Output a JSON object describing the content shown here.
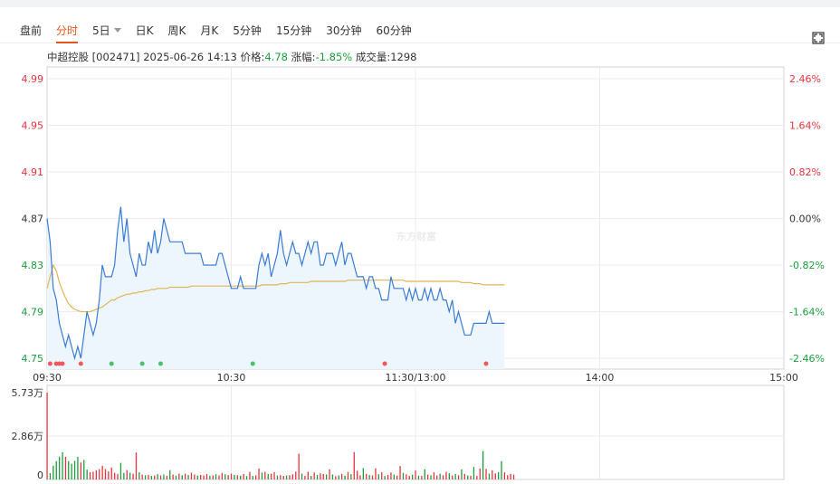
{
  "tabs": [
    {
      "label": "盘前",
      "active": false
    },
    {
      "label": "分时",
      "active": true
    },
    {
      "label": "5日",
      "active": false,
      "dropdown": true
    },
    {
      "label": "日K",
      "active": false
    },
    {
      "label": "周K",
      "active": false
    },
    {
      "label": "月K",
      "active": false
    },
    {
      "label": "5分钟",
      "active": false
    },
    {
      "label": "15分钟",
      "active": false
    },
    {
      "label": "30分钟",
      "active": false
    },
    {
      "label": "60分钟",
      "active": false
    }
  ],
  "fullscreen_icon": "fullscreen-icon",
  "info": {
    "name": "中超控股",
    "code": "[002471]",
    "datetime": "2025-06-26 14:13",
    "price_label": "价格:",
    "price": "4.78",
    "change_label": "涨幅:",
    "change": "-1.85%",
    "volume_label": "成交量:",
    "volume": "1298"
  },
  "watermark": "东方财富",
  "colors": {
    "up": "#e8323c",
    "down": "#1a9d3c",
    "price_line": "#3a7bd5",
    "avg_line": "#e0b458",
    "area_fill": "#eef6fd",
    "active_tab": "#e8541e"
  },
  "chart_data": {
    "type": "line",
    "price_ticks": [
      "4.99",
      "4.95",
      "4.91",
      "4.87",
      "4.83",
      "4.79",
      "4.75"
    ],
    "percent_ticks": [
      "2.46%",
      "1.64%",
      "0.82%",
      "0.00%",
      "-0.82%",
      "-1.64%",
      "-2.46%"
    ],
    "ylim": [
      4.75,
      4.99
    ],
    "prev_close": 4.87,
    "time_ticks": [
      "09:30",
      "10:30",
      "11:30/13:00",
      "14:00",
      "15:00"
    ],
    "volume_ticks": [
      "5.73万",
      "2.86万",
      "0"
    ],
    "volume_max": 57300,
    "series": [
      {
        "values": [
          4.87,
          4.85,
          4.81,
          4.8,
          4.78,
          4.77,
          4.76,
          4.77,
          4.76,
          4.75,
          4.76,
          4.75,
          4.77,
          4.79,
          4.78,
          4.77,
          4.78,
          4.8,
          4.83,
          4.82,
          4.82,
          4.82,
          4.83,
          4.86,
          4.88,
          4.85,
          4.87,
          4.84,
          4.83,
          4.82,
          4.84,
          4.83,
          4.83,
          4.85,
          4.84,
          4.86,
          4.84,
          4.85,
          4.87,
          4.86,
          4.85,
          4.85,
          4.85,
          4.85,
          4.85,
          4.84,
          4.84,
          4.84,
          4.84,
          4.84,
          4.84,
          4.83,
          4.83,
          4.83,
          4.83,
          4.83,
          4.84,
          4.84,
          4.83,
          4.82,
          4.81,
          4.81,
          4.81,
          4.82,
          4.81,
          4.81,
          4.81,
          4.81,
          4.81,
          4.83,
          4.84,
          4.83,
          4.84,
          4.82,
          4.83,
          4.84,
          4.86,
          4.84,
          4.83,
          4.84,
          4.85,
          4.84,
          4.84,
          4.83,
          4.84,
          4.85,
          4.84,
          4.85,
          4.85,
          4.83,
          4.83,
          4.84,
          4.84,
          4.84,
          4.83,
          4.84,
          4.85,
          4.83,
          4.84,
          4.84,
          4.83,
          4.82,
          4.82,
          4.82,
          4.81,
          4.82,
          4.82,
          4.81,
          4.81,
          4.8,
          4.8,
          4.8,
          4.82,
          4.81,
          4.81,
          4.81,
          4.81,
          4.8,
          4.81,
          4.8,
          4.81,
          4.8,
          4.8,
          4.81,
          4.8,
          4.81,
          4.8,
          4.8,
          4.81,
          4.8,
          4.8,
          4.79,
          4.8,
          4.78,
          4.79,
          4.78,
          4.77,
          4.77,
          4.77,
          4.78,
          4.78,
          4.78,
          4.78,
          4.78,
          4.79,
          4.78,
          4.78,
          4.78,
          4.78,
          4.78
        ]
      },
      {
        "values": [
          4.81,
          4.82,
          4.83,
          4.825,
          4.815,
          4.808,
          4.802,
          4.797,
          4.794,
          4.792,
          4.791,
          4.79,
          4.79,
          4.79,
          4.79,
          4.791,
          4.792,
          4.793,
          4.794,
          4.796,
          4.798,
          4.8,
          4.8,
          4.802,
          4.803,
          4.804,
          4.805,
          4.805,
          4.806,
          4.806,
          4.807,
          4.807,
          4.808,
          4.808,
          4.809,
          4.809,
          4.81,
          4.81,
          4.81,
          4.81,
          4.811,
          4.811,
          4.811,
          4.811,
          4.811,
          4.811,
          4.811,
          4.812,
          4.812,
          4.812,
          4.812,
          4.812,
          4.812,
          4.812,
          4.812,
          4.812,
          4.812,
          4.812,
          4.812,
          4.812,
          4.812,
          4.812,
          4.812,
          4.812,
          4.812,
          4.812,
          4.812,
          4.812,
          4.812,
          4.812,
          4.813,
          4.813,
          4.813,
          4.813,
          4.813,
          4.813,
          4.814,
          4.814,
          4.814,
          4.815,
          4.815,
          4.815,
          4.815,
          4.815,
          4.815,
          4.815,
          4.816,
          4.816,
          4.816,
          4.816,
          4.816,
          4.816,
          4.816,
          4.816,
          4.816,
          4.816,
          4.816,
          4.816,
          4.817,
          4.817,
          4.817,
          4.817,
          4.817,
          4.817,
          4.817,
          4.817,
          4.817,
          4.817,
          4.817,
          4.817,
          4.817,
          4.817,
          4.817,
          4.817,
          4.817,
          4.817,
          4.817,
          4.816,
          4.816,
          4.816,
          4.816,
          4.816,
          4.816,
          4.816,
          4.816,
          4.816,
          4.816,
          4.816,
          4.816,
          4.816,
          4.816,
          4.816,
          4.816,
          4.816,
          4.816,
          4.815,
          4.815,
          4.815,
          4.815,
          4.814,
          4.814,
          4.814,
          4.813,
          4.813,
          4.813,
          4.813,
          4.813,
          4.813,
          4.813,
          4.813
        ]
      }
    ],
    "volume": [
      {
        "v": 57300,
        "c": "up"
      },
      {
        "v": 4200,
        "c": "down"
      },
      {
        "v": 9100,
        "c": "down"
      },
      {
        "v": 12100,
        "c": "down"
      },
      {
        "v": 15100,
        "c": "down"
      },
      {
        "v": 18000,
        "c": "down"
      },
      {
        "v": 15000,
        "c": "up"
      },
      {
        "v": 12100,
        "c": "down"
      },
      {
        "v": 10400,
        "c": "down"
      },
      {
        "v": 12300,
        "c": "down"
      },
      {
        "v": 14900,
        "c": "down"
      },
      {
        "v": 11200,
        "c": "up"
      },
      {
        "v": 12900,
        "c": "down"
      },
      {
        "v": 6500,
        "c": "down"
      },
      {
        "v": 4800,
        "c": "up"
      },
      {
        "v": 5100,
        "c": "up"
      },
      {
        "v": 6100,
        "c": "up"
      },
      {
        "v": 6800,
        "c": "up"
      },
      {
        "v": 9000,
        "c": "up"
      },
      {
        "v": 6900,
        "c": "up"
      },
      {
        "v": 5300,
        "c": "up"
      },
      {
        "v": 7900,
        "c": "up"
      },
      {
        "v": 4400,
        "c": "up"
      },
      {
        "v": 3700,
        "c": "up"
      },
      {
        "v": 11000,
        "c": "down"
      },
      {
        "v": 4300,
        "c": "down"
      },
      {
        "v": 6200,
        "c": "up"
      },
      {
        "v": 4400,
        "c": "down"
      },
      {
        "v": 3800,
        "c": "up"
      },
      {
        "v": 17800,
        "c": "up"
      },
      {
        "v": 4800,
        "c": "down"
      },
      {
        "v": 3200,
        "c": "up"
      },
      {
        "v": 2800,
        "c": "down"
      },
      {
        "v": 3100,
        "c": "up"
      },
      {
        "v": 2300,
        "c": "down"
      },
      {
        "v": 2600,
        "c": "up"
      },
      {
        "v": 3500,
        "c": "down"
      },
      {
        "v": 2700,
        "c": "up"
      },
      {
        "v": 3300,
        "c": "down"
      },
      {
        "v": 2400,
        "c": "up"
      },
      {
        "v": 6200,
        "c": "down"
      },
      {
        "v": 3200,
        "c": "up"
      },
      {
        "v": 2500,
        "c": "down"
      },
      {
        "v": 3800,
        "c": "up"
      },
      {
        "v": 2800,
        "c": "down"
      },
      {
        "v": 3800,
        "c": "up"
      },
      {
        "v": 2900,
        "c": "down"
      },
      {
        "v": 4400,
        "c": "up"
      },
      {
        "v": 3300,
        "c": "up"
      },
      {
        "v": 2600,
        "c": "down"
      },
      {
        "v": 3000,
        "c": "up"
      },
      {
        "v": 2700,
        "c": "up"
      },
      {
        "v": 3600,
        "c": "up"
      },
      {
        "v": 2500,
        "c": "down"
      },
      {
        "v": 2700,
        "c": "up"
      },
      {
        "v": 3500,
        "c": "down"
      },
      {
        "v": 2700,
        "c": "up"
      },
      {
        "v": 4300,
        "c": "up"
      },
      {
        "v": 3400,
        "c": "down"
      },
      {
        "v": 2900,
        "c": "up"
      },
      {
        "v": 3900,
        "c": "up"
      },
      {
        "v": 3100,
        "c": "down"
      },
      {
        "v": 2800,
        "c": "up"
      },
      {
        "v": 2500,
        "c": "down"
      },
      {
        "v": 3600,
        "c": "up"
      },
      {
        "v": 2200,
        "c": "down"
      },
      {
        "v": 5000,
        "c": "up"
      },
      {
        "v": 2300,
        "c": "down"
      },
      {
        "v": 2700,
        "c": "up"
      },
      {
        "v": 7300,
        "c": "up"
      },
      {
        "v": 4600,
        "c": "down"
      },
      {
        "v": 5100,
        "c": "up"
      },
      {
        "v": 3700,
        "c": "down"
      },
      {
        "v": 3800,
        "c": "up"
      },
      {
        "v": 4800,
        "c": "up"
      },
      {
        "v": 2500,
        "c": "down"
      },
      {
        "v": 2800,
        "c": "up"
      },
      {
        "v": 2400,
        "c": "up"
      },
      {
        "v": 2600,
        "c": "down"
      },
      {
        "v": 2800,
        "c": "up"
      },
      {
        "v": 3400,
        "c": "up"
      },
      {
        "v": 5200,
        "c": "up"
      },
      {
        "v": 17000,
        "c": "up"
      },
      {
        "v": 3900,
        "c": "down"
      },
      {
        "v": 2400,
        "c": "up"
      },
      {
        "v": 5100,
        "c": "up"
      },
      {
        "v": 2400,
        "c": "down"
      },
      {
        "v": 4600,
        "c": "up"
      },
      {
        "v": 2900,
        "c": "down"
      },
      {
        "v": 4000,
        "c": "up"
      },
      {
        "v": 3600,
        "c": "up"
      },
      {
        "v": 3300,
        "c": "down"
      },
      {
        "v": 6700,
        "c": "up"
      },
      {
        "v": 3300,
        "c": "down"
      },
      {
        "v": 2200,
        "c": "up"
      },
      {
        "v": 2700,
        "c": "down"
      },
      {
        "v": 3700,
        "c": "up"
      },
      {
        "v": 2500,
        "c": "down"
      },
      {
        "v": 4900,
        "c": "up"
      },
      {
        "v": 3500,
        "c": "down"
      },
      {
        "v": 18100,
        "c": "up"
      },
      {
        "v": 5800,
        "c": "up"
      },
      {
        "v": 2700,
        "c": "up"
      },
      {
        "v": 7500,
        "c": "down"
      },
      {
        "v": 3700,
        "c": "up"
      },
      {
        "v": 3000,
        "c": "down"
      },
      {
        "v": 2600,
        "c": "up"
      },
      {
        "v": 7400,
        "c": "up"
      },
      {
        "v": 3400,
        "c": "down"
      },
      {
        "v": 4800,
        "c": "up"
      },
      {
        "v": 2300,
        "c": "down"
      },
      {
        "v": 3000,
        "c": "up"
      },
      {
        "v": 4600,
        "c": "up"
      },
      {
        "v": 3200,
        "c": "down"
      },
      {
        "v": 2600,
        "c": "up"
      },
      {
        "v": 8900,
        "c": "up"
      },
      {
        "v": 4400,
        "c": "down"
      },
      {
        "v": 3400,
        "c": "up"
      },
      {
        "v": 2400,
        "c": "up"
      },
      {
        "v": 3100,
        "c": "down"
      },
      {
        "v": 5900,
        "c": "up"
      },
      {
        "v": 2500,
        "c": "down"
      },
      {
        "v": 2300,
        "c": "up"
      },
      {
        "v": 6800,
        "c": "down"
      },
      {
        "v": 3200,
        "c": "up"
      },
      {
        "v": 2800,
        "c": "down"
      },
      {
        "v": 4700,
        "c": "up"
      },
      {
        "v": 2700,
        "c": "up"
      },
      {
        "v": 3800,
        "c": "down"
      },
      {
        "v": 2800,
        "c": "up"
      },
      {
        "v": 5100,
        "c": "up"
      },
      {
        "v": 4100,
        "c": "down"
      },
      {
        "v": 2600,
        "c": "up"
      },
      {
        "v": 3600,
        "c": "down"
      },
      {
        "v": 2800,
        "c": "up"
      },
      {
        "v": 6600,
        "c": "down"
      },
      {
        "v": 3700,
        "c": "up"
      },
      {
        "v": 2700,
        "c": "down"
      },
      {
        "v": 2500,
        "c": "up"
      },
      {
        "v": 8300,
        "c": "down"
      },
      {
        "v": 2300,
        "c": "up"
      },
      {
        "v": 7300,
        "c": "up"
      },
      {
        "v": 18800,
        "c": "down"
      },
      {
        "v": 7000,
        "c": "up"
      },
      {
        "v": 3900,
        "c": "down"
      },
      {
        "v": 6100,
        "c": "up"
      },
      {
        "v": 4000,
        "c": "up"
      },
      {
        "v": 4800,
        "c": "down"
      },
      {
        "v": 12100,
        "c": "down"
      },
      {
        "v": 4700,
        "c": "up"
      },
      {
        "v": 2800,
        "c": "up"
      },
      {
        "v": 3700,
        "c": "up"
      },
      {
        "v": 3200,
        "c": "up"
      }
    ],
    "buy_markers": [
      {
        "i": 1,
        "c": "up"
      },
      {
        "i": 3,
        "c": "up"
      },
      {
        "i": 4,
        "c": "up"
      },
      {
        "i": 5,
        "c": "up"
      },
      {
        "i": 11,
        "c": "up"
      },
      {
        "i": 21,
        "c": "down"
      },
      {
        "i": 31,
        "c": "down"
      },
      {
        "i": 37,
        "c": "down"
      },
      {
        "i": 67,
        "c": "down"
      },
      {
        "i": 110,
        "c": "up"
      },
      {
        "i": 143,
        "c": "up"
      }
    ]
  }
}
